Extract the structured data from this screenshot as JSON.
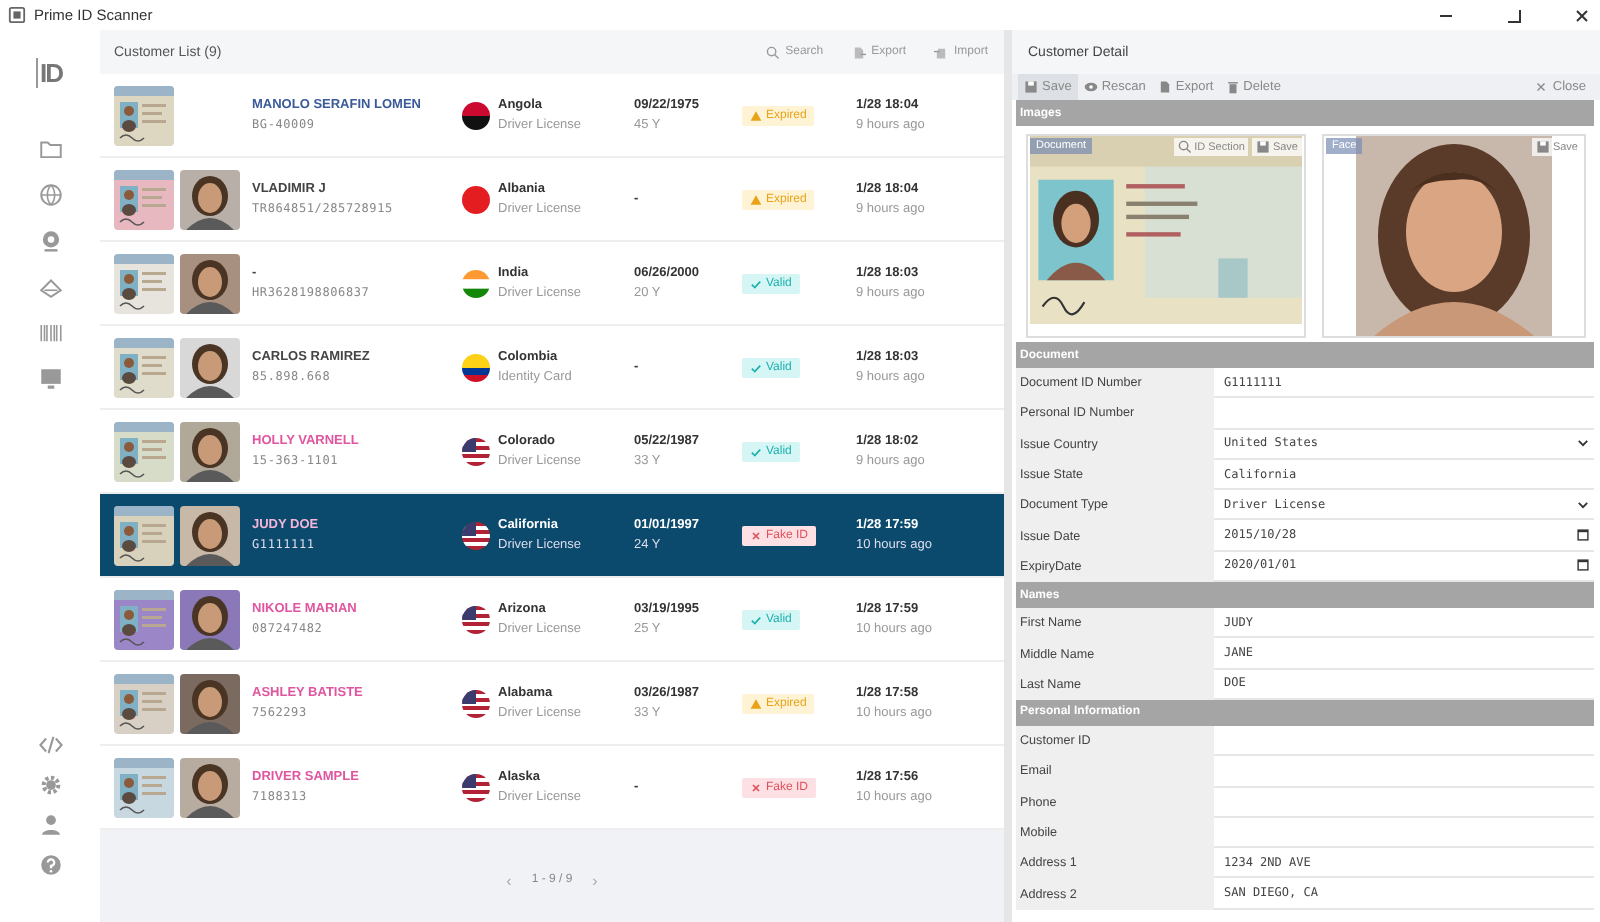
{
  "window": {
    "title": "Prime ID Scanner"
  },
  "sidebar": {
    "logo": "ID"
  },
  "customer_list": {
    "title": "Customer List (9)",
    "actions": [
      {
        "kind": "search",
        "label": "Search"
      },
      {
        "kind": "export",
        "label": "Export"
      },
      {
        "kind": "import",
        "label": "Import"
      }
    ],
    "customers": [
      {
        "name": "MANOLO SERAFIN LOMEN",
        "id_number": "BG-40009",
        "color": "#3a5a9a",
        "face_photo": false,
        "region": "Angola",
        "doc_type": "Driver License",
        "dob": "09/22/1975",
        "age": "45 Y",
        "status": {
          "kind": "expired",
          "label": "Expired"
        },
        "time": "1/28 18:04",
        "ago": "9 hours ago",
        "selected": false
      },
      {
        "name": "VLADIMIR J",
        "id_number": "TR864851/285728915",
        "color": "#444444",
        "face_photo": true,
        "region": "Albania",
        "doc_type": "Driver License",
        "dob": "-",
        "status": {
          "kind": "expired",
          "label": "Expired"
        },
        "time": "1/28 18:04",
        "ago": "9 hours ago",
        "selected": false
      },
      {
        "name": "-",
        "id_number": "HR3628198806837",
        "face_photo": true,
        "region": "India",
        "doc_type": "Driver License",
        "dob": "06/26/2000",
        "age": "20 Y",
        "status": {
          "kind": "valid",
          "label": "Valid"
        },
        "time": "1/28 18:03",
        "ago": "9 hours ago",
        "selected": false
      },
      {
        "name": "CARLOS RAMIREZ",
        "id_number": "85.898.668",
        "color": "#444444",
        "face_photo": true,
        "region": "Colombia",
        "doc_type": "Identity Card",
        "dob": "-",
        "status": {
          "kind": "valid",
          "label": "Valid"
        },
        "time": "1/28 18:03",
        "ago": "9 hours ago",
        "selected": false
      },
      {
        "name": "HOLLY VARNELL",
        "id_number": "15-363-1101",
        "color": "#e0559f",
        "face_photo": true,
        "region": "Colorado",
        "doc_type": "Driver License",
        "dob": "05/22/1987",
        "age": "33 Y",
        "status": {
          "kind": "valid",
          "label": "Valid"
        },
        "time": "1/28 18:02",
        "ago": "9 hours ago",
        "selected": false
      },
      {
        "name": "JUDY DOE",
        "id_number": "G1111111",
        "color": "#f4b6d8",
        "face_photo": true,
        "region": "California",
        "doc_type": "Driver License",
        "dob": "01/01/1997",
        "age": "24 Y",
        "status": {
          "kind": "fake",
          "label": "Fake ID"
        },
        "time": "1/28 17:59",
        "ago": "10 hours ago",
        "selected": true
      },
      {
        "name": "NIKOLE MARIAN",
        "id_number": "087247482",
        "color": "#e0559f",
        "face_photo": true,
        "region": "Arizona",
        "doc_type": "Driver License",
        "dob": "03/19/1995",
        "age": "25 Y",
        "status": {
          "kind": "valid",
          "label": "Valid"
        },
        "time": "1/28 17:59",
        "ago": "10 hours ago",
        "selected": false
      },
      {
        "name": "ASHLEY BATISTE",
        "id_number": "7562293",
        "color": "#e0559f",
        "face_photo": true,
        "region": "Alabama",
        "doc_type": "Driver License",
        "dob": "03/26/1987",
        "age": "33 Y",
        "status": {
          "kind": "expired",
          "label": "Expired"
        },
        "time": "1/28 17:58",
        "ago": "10 hours ago",
        "selected": false
      },
      {
        "name": "DRIVER SAMPLE",
        "id_number": "7188313",
        "color": "#e0559f",
        "face_photo": true,
        "region": "Alaska",
        "doc_type": "Driver License",
        "dob": "-",
        "status": {
          "kind": "fake",
          "label": "Fake ID"
        },
        "time": "1/28 17:56",
        "ago": "10 hours ago",
        "selected": false
      }
    ],
    "pagination": {
      "prev": "‹",
      "range": "1 - 9 / 9",
      "next": "›"
    }
  },
  "detail": {
    "title": "Customer Detail",
    "toolbar": [
      {
        "kind": "save",
        "label": "Save",
        "disabled": true
      },
      {
        "kind": "rescan",
        "label": "Rescan",
        "disabled": false
      },
      {
        "kind": "export",
        "label": "Export",
        "disabled": false
      },
      {
        "kind": "delete",
        "label": "Delete",
        "disabled": false
      }
    ],
    "close": "Close",
    "images": {
      "title": "Images",
      "document": {
        "tag": "Document",
        "section": "ID Section",
        "save": "Save"
      },
      "face": {
        "tag": "Face",
        "save": "Save"
      }
    },
    "sections": [
      {
        "title": "Document",
        "fields": [
          {
            "label": "Document ID Number",
            "kind": "text",
            "value": "G1111111"
          },
          {
            "label": "Personal ID Number",
            "kind": "text"
          },
          {
            "label": "Issue Country",
            "kind": "select",
            "value": "United States"
          },
          {
            "label": "Issue State",
            "kind": "text",
            "value": "California"
          },
          {
            "label": "Document Type",
            "kind": "select",
            "value": "Driver License"
          },
          {
            "label": "Issue Date",
            "kind": "date",
            "value": "2015/10/28"
          },
          {
            "label": "ExpiryDate",
            "kind": "date",
            "value": "2020/01/01"
          }
        ]
      },
      {
        "title": "Names",
        "fields": [
          {
            "label": "First Name",
            "kind": "text",
            "value": "JUDY"
          },
          {
            "label": "Middle Name",
            "kind": "text",
            "value": "JANE"
          },
          {
            "label": "Last Name",
            "kind": "text",
            "value": "DOE"
          }
        ]
      },
      {
        "title": "Personal Information",
        "fields": [
          {
            "label": "Customer ID",
            "kind": "text"
          },
          {
            "label": "Email",
            "kind": "text"
          },
          {
            "label": "Phone",
            "kind": "text"
          },
          {
            "label": "Mobile",
            "kind": "text"
          },
          {
            "label": "Address 1",
            "kind": "text",
            "value": "1234 2ND AVE"
          },
          {
            "label": "Address 2",
            "kind": "text",
            "value": "SAN DIEGO, CA"
          }
        ]
      }
    ]
  }
}
